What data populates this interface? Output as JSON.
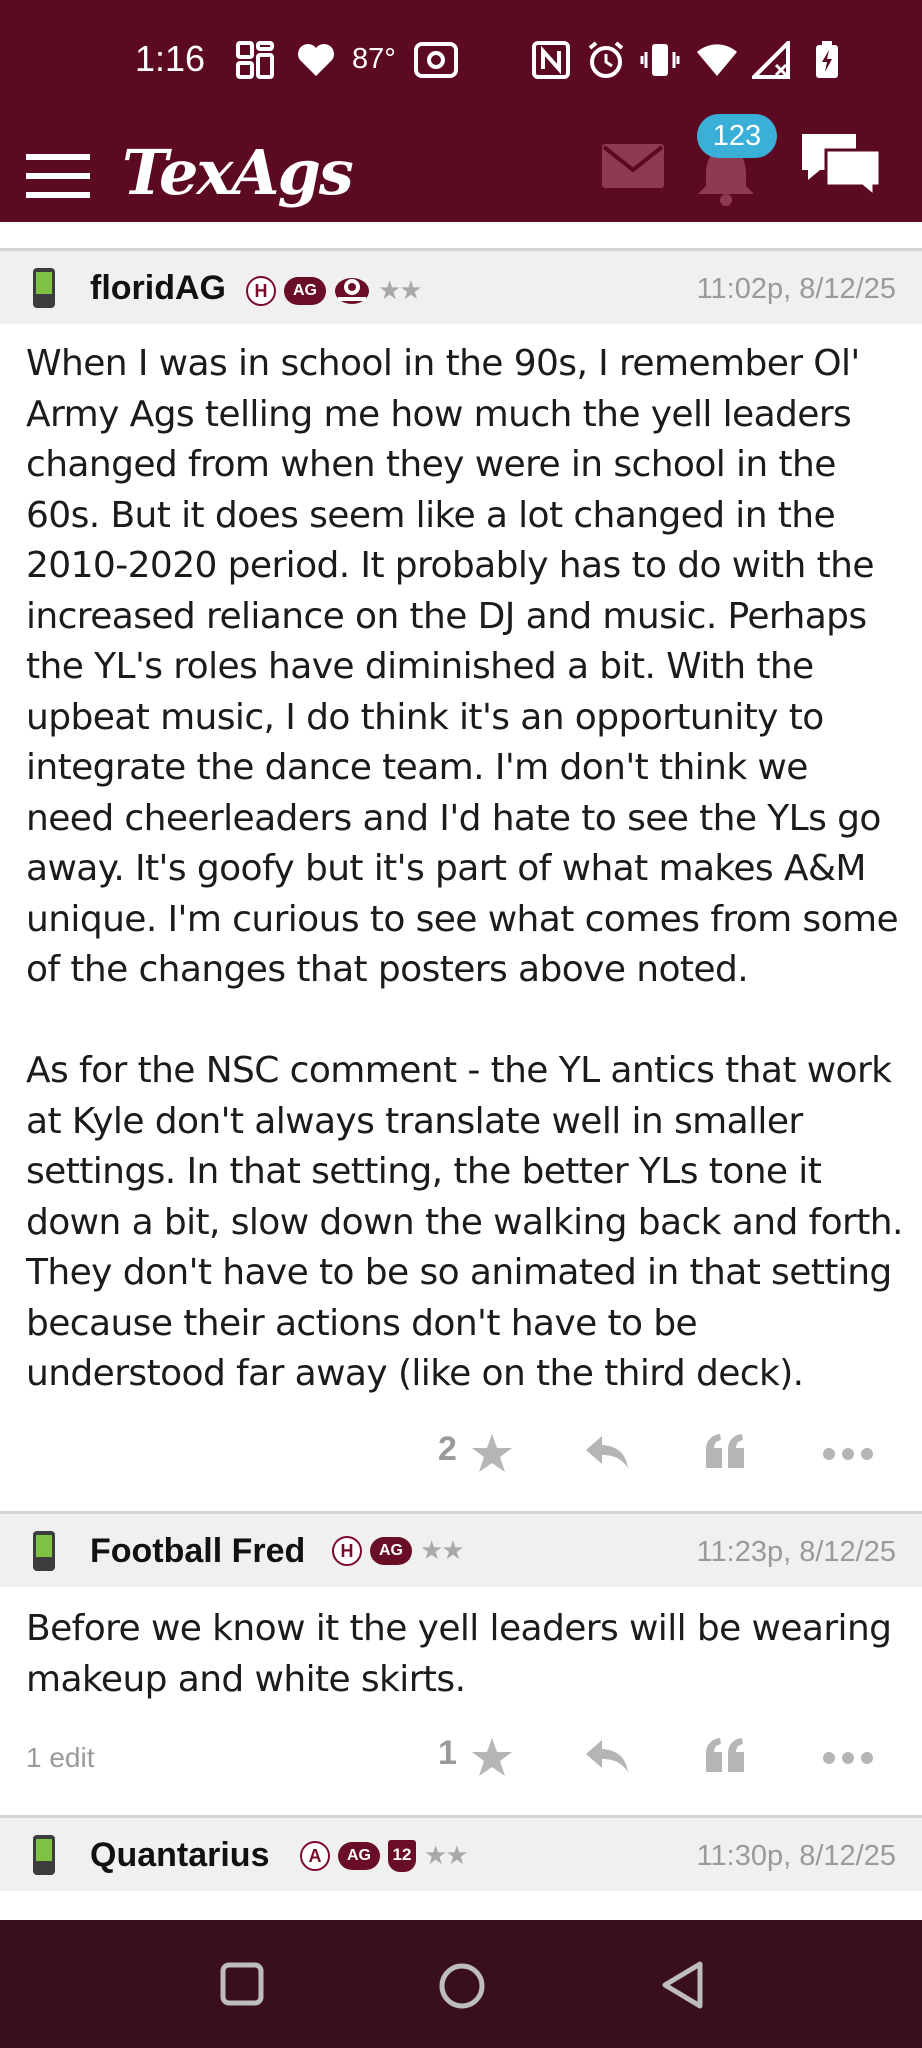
{
  "status_bar": {
    "time": "1:16",
    "temperature": "87°"
  },
  "app": {
    "title": "TexAgs",
    "notification_count": "123"
  },
  "posts": [
    {
      "username": "floridAG",
      "badges": [
        "H",
        "AG"
      ],
      "stars": "★★",
      "timestamp": "11:02p, 8/12/25",
      "body": "When I was in school in the 90s, I remember Ol' Army Ags telling me how much the yell leaders changed from when they were in school in the 60s. But it does seem like a lot changed in the 2010-2020 period. It probably has to do with the increased reliance on the DJ and music. Perhaps the YL's roles have diminished a bit. With the upbeat music, I do think it's an opportunity to integrate the dance team. I'm don't think we need cheerleaders and I'd hate to see the YLs go away. It's goofy but it's part of what makes A&M unique. I'm curious to see what comes from some of the changes that posters above noted.\n\nAs for the NSC comment - the YL antics that work at Kyle don't always translate well in smaller settings. In that setting, the better YLs tone it down a bit, slow down the walking back and forth. They don't have to be so animated in that setting because their actions don't have to be understood far away (like on the third deck).",
      "star_count": "2",
      "edit_note": ""
    },
    {
      "username": "Football Fred",
      "badges": [
        "H",
        "AG"
      ],
      "stars": "★★",
      "timestamp": "11:23p, 8/12/25",
      "body": "Before we know it the yell leaders will be wearing makeup and white skirts.",
      "star_count": "1",
      "edit_note": "1 edit"
    },
    {
      "username": "Quantarius",
      "badges": [
        "A",
        "AG",
        "12"
      ],
      "stars": "★★",
      "timestamp": "11:30p, 8/12/25"
    }
  ],
  "colors": {
    "brand_maroon": "#5c0a22",
    "badge_blue": "#3ab0d9",
    "nav_bar": "#3a0f1c"
  }
}
